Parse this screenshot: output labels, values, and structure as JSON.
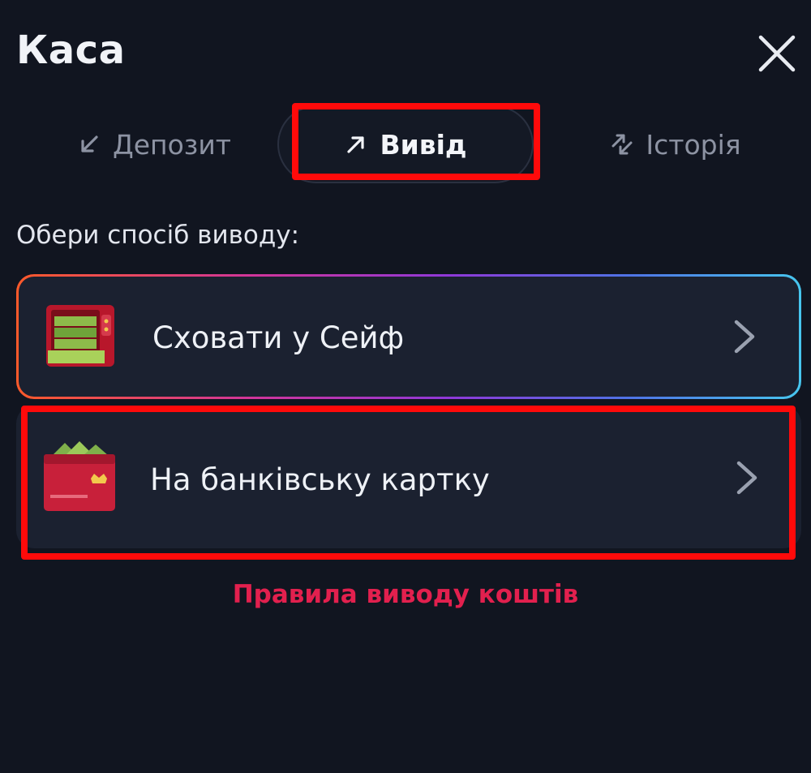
{
  "header": {
    "title": "Каса",
    "close_icon": "close-icon"
  },
  "tabs": [
    {
      "label": "Депозит",
      "icon": "arrow-down-left-icon",
      "active": false
    },
    {
      "label": "Вивід",
      "icon": "arrow-up-right-icon",
      "active": true
    },
    {
      "label": "Історія",
      "icon": "swap-arrows-icon",
      "active": false
    }
  ],
  "subtitle": "Обери спосіб виводу:",
  "options": [
    {
      "label": "Сховати у Сейф",
      "icon": "safe-with-money-icon",
      "chevron": "chevron-right-icon"
    },
    {
      "label": "На банківську картку",
      "icon": "wallet-card-icon",
      "chevron": "chevron-right-icon"
    }
  ],
  "rules_link": "Правила виводу коштів",
  "colors": {
    "background": "#111520",
    "card": "#1b2130",
    "accent_link": "#e2204e",
    "highlight": "#ff0a0a"
  }
}
